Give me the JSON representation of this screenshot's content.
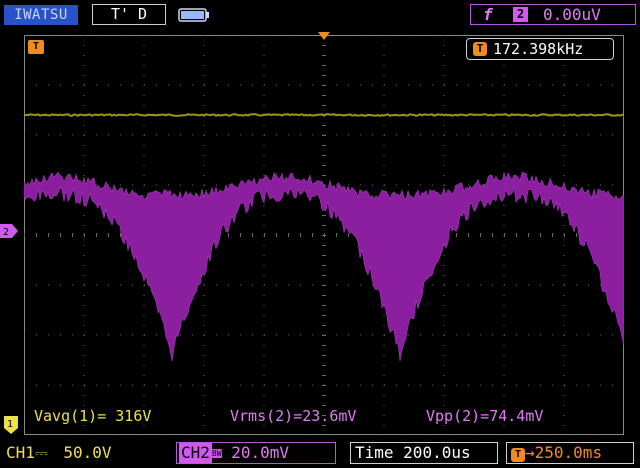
{
  "header": {
    "brand": "IWATSU",
    "run_state": "T' D",
    "trigger_slope": "f",
    "trigger_source": "2",
    "trigger_level": "0.00uV"
  },
  "display": {
    "frequency_icon": "T",
    "frequency": "172.398kHz",
    "trigger_position_icon": "T"
  },
  "measurements": [
    {
      "label": "Vavg(1)",
      "value": "316V",
      "text": "Vavg(1)= 316V"
    },
    {
      "label": "Vrms(2)",
      "value": "23.6mV",
      "text": "Vrms(2)=23.6mV"
    },
    {
      "label": "Vpp(2)",
      "value": "74.4mV",
      "text": "Vpp(2)=74.4mV"
    }
  ],
  "status_bar": {
    "ch1_label": "CH1",
    "ch1_coupling": "⎓",
    "ch1_scale": "50.0V",
    "ch2_label": "CH2",
    "ch2_bw": "BW",
    "ch2_scale": "20.0mV",
    "time_label": "Time",
    "time_scale": "200.0us",
    "trigger_delay": "250.0ms"
  },
  "colors": {
    "ch1": "#ede14a",
    "ch1_trace": "#9c9620",
    "ch2": "#e07cf4",
    "ch2_trace": "#8c1fa0",
    "trigger": "#f08c1e",
    "brand_bg": "#2a52c8",
    "battery": "#9bb8ff"
  }
}
